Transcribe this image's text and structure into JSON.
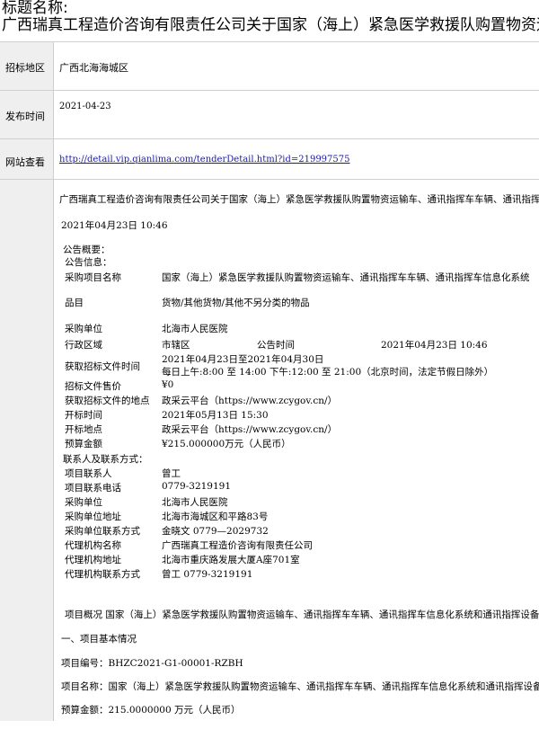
{
  "title_label": "标题名称:",
  "title": "广西瑞真工程造价咨询有限责任公司关于国家（海上）紧急医学救援队购置物资运输车、通讯指挥车车辆、通讯指挥车信息化系统和通讯指挥设备采购",
  "rows": {
    "region": {
      "label": "招标地区",
      "value": "广西北海海城区"
    },
    "date": {
      "label": "发布时间",
      "value": "2021-04-23"
    },
    "site": {
      "label": "网站查看",
      "value": "http://detail.vip.qianlima.com/tenderDetail.html?id=219997575"
    },
    "content": {
      "heading": "广西瑞真工程造价咨询有限责任公司关于国家（海上）紧急医学救援队购置物资运输车、通讯指挥车车辆、通讯指挥车信息化系统",
      "datetime": "2021年04月23日  10:46",
      "overview": "公告概要：",
      "info": "公告信息：",
      "f_name_l": "采购项目名称",
      "f_name_v": "国家（海上）紧急医学救援队购置物资运输车、通讯指挥车车辆、通讯指挥车信息化系统",
      "f_item_l": "品目",
      "f_item_v": "货物/其他货物/其他不另分类的物品",
      "f_unit_l": "采购单位",
      "f_unit_v": "北海市人民医院",
      "f_area_l": "行政区域",
      "f_area_v": "市辖区",
      "f_pub_l": "公告时间",
      "f_pub_v": "2021年04月23日  10:46",
      "f_get_l": "获取招标文件时间",
      "f_get_v1": "2021年04月23日至2021年04月30日",
      "f_get_v2": "每日上午:8:00 至 14:00  下午:12:00 至 21:00（北京时间，法定节假日除外）",
      "f_price_l": "招标文件售价",
      "f_price_v": "¥0",
      "f_place_l": "获取招标文件的地点",
      "f_place_v": "政采云平台（https://www.zcygov.cn/）",
      "f_open_l": "开标时间",
      "f_open_v": "2021年05月13日  15:30",
      "f_openp_l": "开标地点",
      "f_openp_v": "政采云平台（https://www.zcygov.cn/）",
      "f_budget_l": "预算金额",
      "f_budget_v": "¥215.000000万元（人民币）",
      "contact": "联系人及联系方式：",
      "c1_l": "项目联系人",
      "c1_v": "曾工",
      "c2_l": "项目联系电话",
      "c2_v": "0779-3219191",
      "c3_l": "采购单位",
      "c3_v": "北海市人民医院",
      "c4_l": "采购单位地址",
      "c4_v": "北海市海城区和平路83号",
      "c5_l": "采购单位联系方式",
      "c5_v": "金晓文 0779—2029732",
      "c6_l": "代理机构名称",
      "c6_v": "广西瑞真工程造价咨询有限责任公司",
      "c7_l": "代理机构地址",
      "c7_v": "北海市重庆路发展大厦A座701室",
      "c8_l": "代理机构联系方式",
      "c8_v": "曾工 0779-3219191",
      "p1": "项目概况  国家（海上）紧急医学救援队购置物资运输车、通讯指挥车车辆、通讯指挥车信息化系统和通讯指挥设备采购",
      "p2": "一、项目基本情况",
      "p3": "项目编号：BHZC2021-G1-00001-RZBH",
      "p4": "项目名称：国家（海上）紧急医学救援队购置物资运输车、通讯指挥车车辆、通讯指挥车信息化系统和通讯指挥设备采购",
      "p5": "预算金额：215.0000000 万元（人民币）"
    }
  }
}
